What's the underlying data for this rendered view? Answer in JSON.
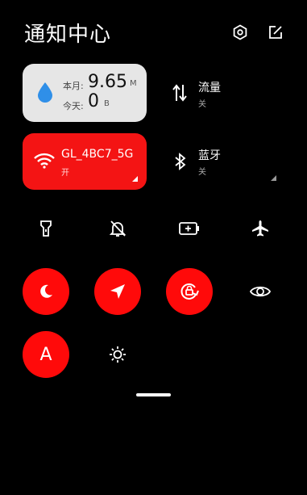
{
  "header": {
    "title": "通知中心",
    "icons": [
      "settings-icon",
      "edit-icon"
    ]
  },
  "data_usage": {
    "month_label": "本月:",
    "month_value": "9.65",
    "month_unit": "M",
    "today_label": "今天:",
    "today_value": "0",
    "today_unit": "B"
  },
  "mobile_data": {
    "title": "流量",
    "status": "关"
  },
  "wifi": {
    "name": "GL_4BC7_5G",
    "status": "开"
  },
  "bluetooth": {
    "title": "蓝牙",
    "status": "关"
  },
  "toggles_row1": [
    {
      "icon": "flashlight-icon",
      "active": false
    },
    {
      "icon": "mute-icon",
      "active": false
    },
    {
      "icon": "battery-saver-icon",
      "active": false
    },
    {
      "icon": "airplane-icon",
      "active": false
    }
  ],
  "toggles_row2": [
    {
      "icon": "dark-mode-icon",
      "active": true
    },
    {
      "icon": "location-icon",
      "active": true
    },
    {
      "icon": "auto-rotate-icon",
      "active": true
    },
    {
      "icon": "eye-icon",
      "active": false
    }
  ],
  "toggles_row3": [
    {
      "icon": "auto-brightness-icon",
      "label": "A",
      "active": true
    },
    {
      "icon": "brightness-icon",
      "active": false
    }
  ],
  "colors": {
    "accent": "#ff0a0a",
    "card_light": "#e6e6e6",
    "background": "#000000"
  }
}
